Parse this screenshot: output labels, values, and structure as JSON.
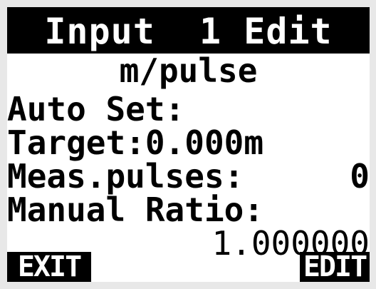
{
  "screen": {
    "title": "Input  1 Edit",
    "subtitle": "m/pulse",
    "auto_set_label": "Auto Set:",
    "target_label": "Target:0.000m",
    "meas_pulses_label": "Meas.pulses:",
    "meas_pulses_value": "0",
    "manual_ratio_label": "Manual Ratio:",
    "manual_ratio_value": "1.000000"
  },
  "softkeys": {
    "left": "EXIT",
    "right": "EDIT"
  },
  "colors": {
    "background": "#ffffff",
    "foreground": "#000000",
    "bezel": "#e8e8e8"
  }
}
